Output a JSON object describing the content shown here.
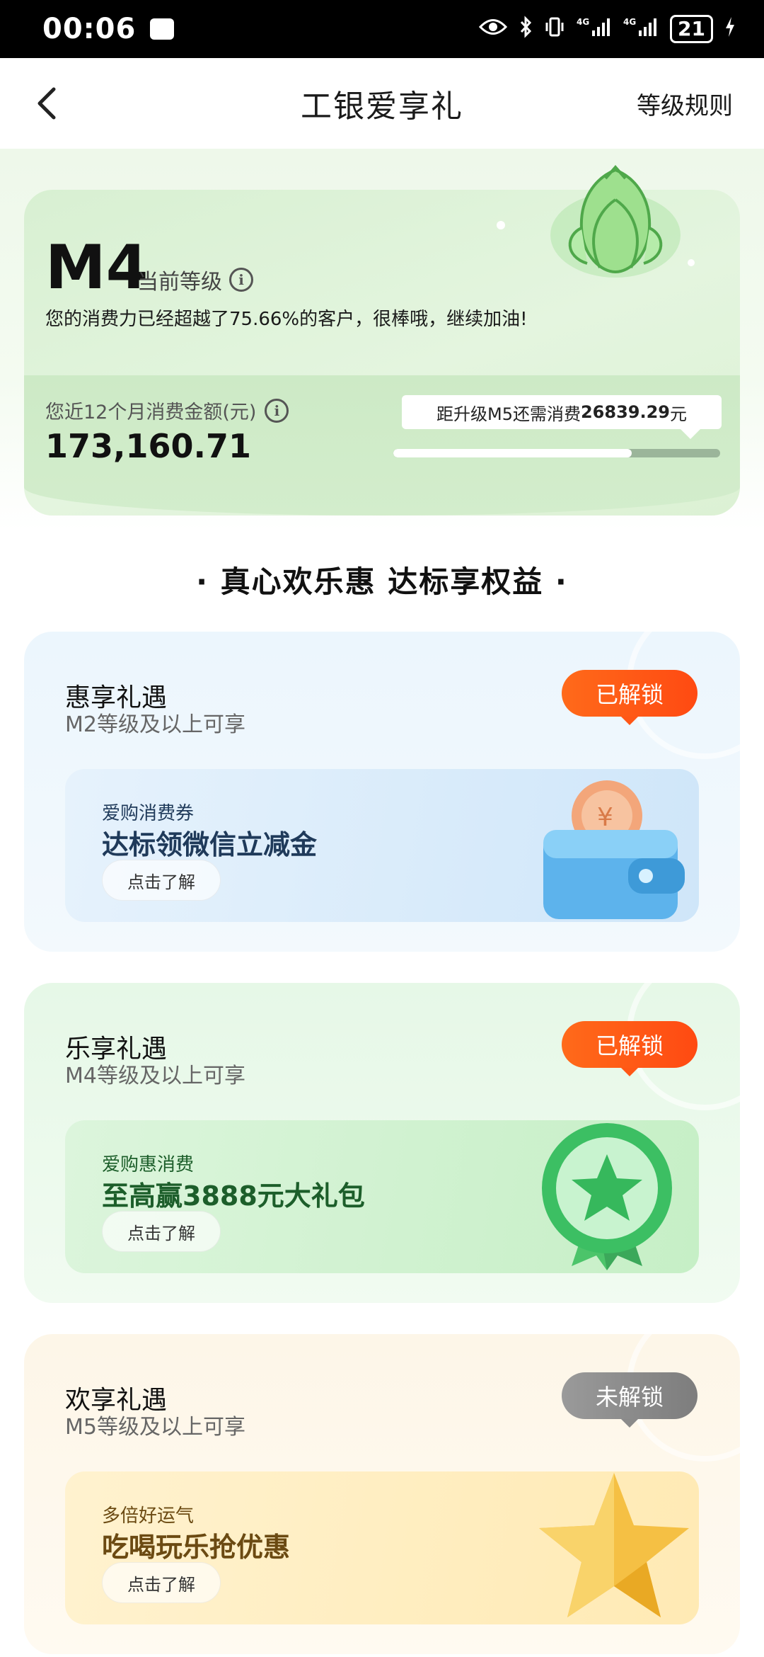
{
  "status_bar": {
    "time": "00:06",
    "network_1": "4G",
    "network_2": "4G",
    "battery": "21",
    "icons": [
      "eye-icon",
      "bluetooth-icon",
      "vibrate-icon",
      "signal-icon",
      "signal-icon",
      "battery-icon",
      "charging-icon"
    ]
  },
  "nav": {
    "title": "工银爱享礼",
    "rules_link": "等级规则",
    "back_icon": "chevron-left-icon"
  },
  "level": {
    "current": "M4",
    "current_label": "当前等级",
    "description": "您的消费力已经超越了75.66%的客户，很棒哦，继续加油!",
    "spend_label": "您近12个月消费金额(元)",
    "spend_value": "173,160.71",
    "upgrade_prefix": "距升级M5还需消费",
    "upgrade_amount": "26839.29",
    "upgrade_suffix": "元",
    "progress_fraction": 0.73
  },
  "section_title": "· 真心欢乐惠 达标享权益 ·",
  "benefits": [
    {
      "title": "惠享礼遇",
      "requirement": "M2等级及以上可享",
      "status": "已解锁",
      "status_unlocked": true,
      "promo_label": "爱购消费券",
      "promo_title": "达标领微信立减金",
      "button": "点击了解",
      "icon": "wallet-icon"
    },
    {
      "title": "乐享礼遇",
      "requirement": "M4等级及以上可享",
      "status": "已解锁",
      "status_unlocked": true,
      "promo_label": "爱购惠消费",
      "promo_title": "至高赢3888元大礼包",
      "button": "点击了解",
      "icon": "star-medal-icon"
    },
    {
      "title": "欢享礼遇",
      "requirement": "M5等级及以上可享",
      "status": "未解锁",
      "status_unlocked": false,
      "promo_label": "多倍好运气",
      "promo_title": "吃喝玩乐抢优惠",
      "button": "点击了解",
      "icon": "gold-star-icon"
    }
  ],
  "colors": {
    "accent_orange": "#ff5716",
    "locked_gray": "#8a8a8a",
    "level_green": "#d8f0d2"
  }
}
